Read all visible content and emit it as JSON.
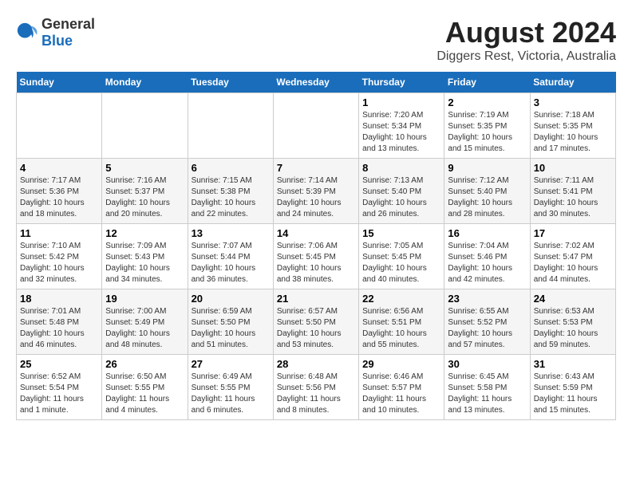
{
  "logo": {
    "text_general": "General",
    "text_blue": "Blue"
  },
  "title": "August 2024",
  "subtitle": "Diggers Rest, Victoria, Australia",
  "days_of_week": [
    "Sunday",
    "Monday",
    "Tuesday",
    "Wednesday",
    "Thursday",
    "Friday",
    "Saturday"
  ],
  "weeks": [
    [
      {
        "day": "",
        "info": ""
      },
      {
        "day": "",
        "info": ""
      },
      {
        "day": "",
        "info": ""
      },
      {
        "day": "",
        "info": ""
      },
      {
        "day": "1",
        "info": "Sunrise: 7:20 AM\nSunset: 5:34 PM\nDaylight: 10 hours\nand 13 minutes."
      },
      {
        "day": "2",
        "info": "Sunrise: 7:19 AM\nSunset: 5:35 PM\nDaylight: 10 hours\nand 15 minutes."
      },
      {
        "day": "3",
        "info": "Sunrise: 7:18 AM\nSunset: 5:35 PM\nDaylight: 10 hours\nand 17 minutes."
      }
    ],
    [
      {
        "day": "4",
        "info": "Sunrise: 7:17 AM\nSunset: 5:36 PM\nDaylight: 10 hours\nand 18 minutes."
      },
      {
        "day": "5",
        "info": "Sunrise: 7:16 AM\nSunset: 5:37 PM\nDaylight: 10 hours\nand 20 minutes."
      },
      {
        "day": "6",
        "info": "Sunrise: 7:15 AM\nSunset: 5:38 PM\nDaylight: 10 hours\nand 22 minutes."
      },
      {
        "day": "7",
        "info": "Sunrise: 7:14 AM\nSunset: 5:39 PM\nDaylight: 10 hours\nand 24 minutes."
      },
      {
        "day": "8",
        "info": "Sunrise: 7:13 AM\nSunset: 5:40 PM\nDaylight: 10 hours\nand 26 minutes."
      },
      {
        "day": "9",
        "info": "Sunrise: 7:12 AM\nSunset: 5:40 PM\nDaylight: 10 hours\nand 28 minutes."
      },
      {
        "day": "10",
        "info": "Sunrise: 7:11 AM\nSunset: 5:41 PM\nDaylight: 10 hours\nand 30 minutes."
      }
    ],
    [
      {
        "day": "11",
        "info": "Sunrise: 7:10 AM\nSunset: 5:42 PM\nDaylight: 10 hours\nand 32 minutes."
      },
      {
        "day": "12",
        "info": "Sunrise: 7:09 AM\nSunset: 5:43 PM\nDaylight: 10 hours\nand 34 minutes."
      },
      {
        "day": "13",
        "info": "Sunrise: 7:07 AM\nSunset: 5:44 PM\nDaylight: 10 hours\nand 36 minutes."
      },
      {
        "day": "14",
        "info": "Sunrise: 7:06 AM\nSunset: 5:45 PM\nDaylight: 10 hours\nand 38 minutes."
      },
      {
        "day": "15",
        "info": "Sunrise: 7:05 AM\nSunset: 5:45 PM\nDaylight: 10 hours\nand 40 minutes."
      },
      {
        "day": "16",
        "info": "Sunrise: 7:04 AM\nSunset: 5:46 PM\nDaylight: 10 hours\nand 42 minutes."
      },
      {
        "day": "17",
        "info": "Sunrise: 7:02 AM\nSunset: 5:47 PM\nDaylight: 10 hours\nand 44 minutes."
      }
    ],
    [
      {
        "day": "18",
        "info": "Sunrise: 7:01 AM\nSunset: 5:48 PM\nDaylight: 10 hours\nand 46 minutes."
      },
      {
        "day": "19",
        "info": "Sunrise: 7:00 AM\nSunset: 5:49 PM\nDaylight: 10 hours\nand 48 minutes."
      },
      {
        "day": "20",
        "info": "Sunrise: 6:59 AM\nSunset: 5:50 PM\nDaylight: 10 hours\nand 51 minutes."
      },
      {
        "day": "21",
        "info": "Sunrise: 6:57 AM\nSunset: 5:50 PM\nDaylight: 10 hours\nand 53 minutes."
      },
      {
        "day": "22",
        "info": "Sunrise: 6:56 AM\nSunset: 5:51 PM\nDaylight: 10 hours\nand 55 minutes."
      },
      {
        "day": "23",
        "info": "Sunrise: 6:55 AM\nSunset: 5:52 PM\nDaylight: 10 hours\nand 57 minutes."
      },
      {
        "day": "24",
        "info": "Sunrise: 6:53 AM\nSunset: 5:53 PM\nDaylight: 10 hours\nand 59 minutes."
      }
    ],
    [
      {
        "day": "25",
        "info": "Sunrise: 6:52 AM\nSunset: 5:54 PM\nDaylight: 11 hours\nand 1 minute."
      },
      {
        "day": "26",
        "info": "Sunrise: 6:50 AM\nSunset: 5:55 PM\nDaylight: 11 hours\nand 4 minutes."
      },
      {
        "day": "27",
        "info": "Sunrise: 6:49 AM\nSunset: 5:55 PM\nDaylight: 11 hours\nand 6 minutes."
      },
      {
        "day": "28",
        "info": "Sunrise: 6:48 AM\nSunset: 5:56 PM\nDaylight: 11 hours\nand 8 minutes."
      },
      {
        "day": "29",
        "info": "Sunrise: 6:46 AM\nSunset: 5:57 PM\nDaylight: 11 hours\nand 10 minutes."
      },
      {
        "day": "30",
        "info": "Sunrise: 6:45 AM\nSunset: 5:58 PM\nDaylight: 11 hours\nand 13 minutes."
      },
      {
        "day": "31",
        "info": "Sunrise: 6:43 AM\nSunset: 5:59 PM\nDaylight: 11 hours\nand 15 minutes."
      }
    ]
  ]
}
